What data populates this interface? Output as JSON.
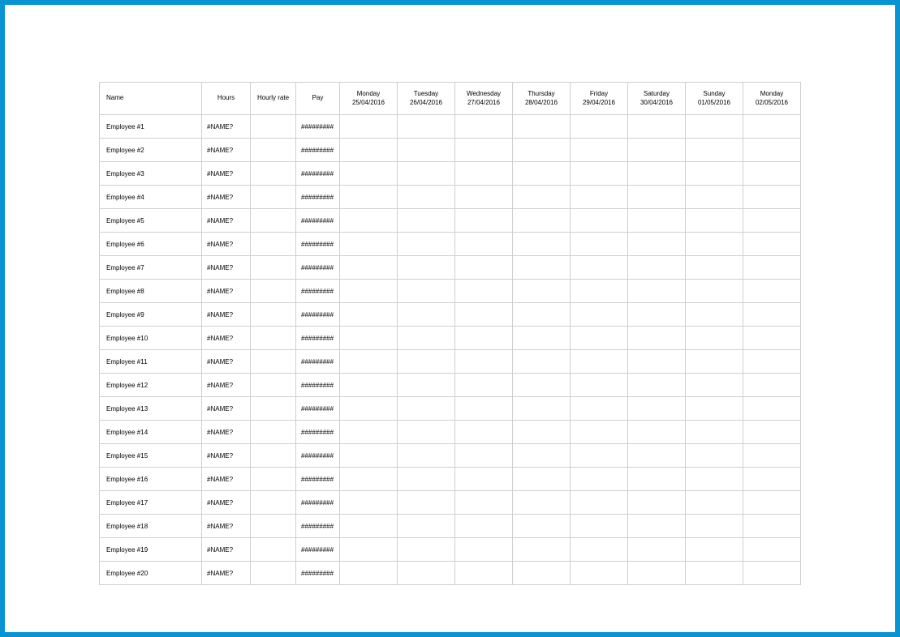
{
  "headers": {
    "name": "Name",
    "hours": "Hours",
    "rate": "Hourly rate",
    "pay": "Pay",
    "days": [
      {
        "dow": "Monday",
        "date": "25/04/2016"
      },
      {
        "dow": "Tuesday",
        "date": "26/04/2016"
      },
      {
        "dow": "Wednesday",
        "date": "27/04/2016"
      },
      {
        "dow": "Thursday",
        "date": "28/04/2016"
      },
      {
        "dow": "Friday",
        "date": "29/04/2016"
      },
      {
        "dow": "Saturday",
        "date": "30/04/2016"
      },
      {
        "dow": "Sunday",
        "date": "01/05/2016"
      },
      {
        "dow": "Monday",
        "date": "02/05/2016"
      }
    ]
  },
  "rows": [
    {
      "name": "Employee #1",
      "hours": "#NAME?",
      "rate": "",
      "pay": "#########",
      "days": [
        "",
        "",
        "",
        "",
        "",
        "",
        "",
        ""
      ]
    },
    {
      "name": "Employee #2",
      "hours": "#NAME?",
      "rate": "",
      "pay": "#########",
      "days": [
        "",
        "",
        "",
        "",
        "",
        "",
        "",
        ""
      ]
    },
    {
      "name": "Employee #3",
      "hours": "#NAME?",
      "rate": "",
      "pay": "#########",
      "days": [
        "",
        "",
        "",
        "",
        "",
        "",
        "",
        ""
      ]
    },
    {
      "name": "Employee #4",
      "hours": "#NAME?",
      "rate": "",
      "pay": "#########",
      "days": [
        "",
        "",
        "",
        "",
        "",
        "",
        "",
        ""
      ]
    },
    {
      "name": "Employee #5",
      "hours": "#NAME?",
      "rate": "",
      "pay": "#########",
      "days": [
        "",
        "",
        "",
        "",
        "",
        "",
        "",
        ""
      ]
    },
    {
      "name": "Employee #6",
      "hours": "#NAME?",
      "rate": "",
      "pay": "#########",
      "days": [
        "",
        "",
        "",
        "",
        "",
        "",
        "",
        ""
      ]
    },
    {
      "name": "Employee #7",
      "hours": "#NAME?",
      "rate": "",
      "pay": "#########",
      "days": [
        "",
        "",
        "",
        "",
        "",
        "",
        "",
        ""
      ]
    },
    {
      "name": "Employee #8",
      "hours": "#NAME?",
      "rate": "",
      "pay": "#########",
      "days": [
        "",
        "",
        "",
        "",
        "",
        "",
        "",
        ""
      ]
    },
    {
      "name": "Employee #9",
      "hours": "#NAME?",
      "rate": "",
      "pay": "#########",
      "days": [
        "",
        "",
        "",
        "",
        "",
        "",
        "",
        ""
      ]
    },
    {
      "name": "Employee #10",
      "hours": "#NAME?",
      "rate": "",
      "pay": "#########",
      "days": [
        "",
        "",
        "",
        "",
        "",
        "",
        "",
        ""
      ]
    },
    {
      "name": "Employee #11",
      "hours": "#NAME?",
      "rate": "",
      "pay": "#########",
      "days": [
        "",
        "",
        "",
        "",
        "",
        "",
        "",
        ""
      ]
    },
    {
      "name": "Employee #12",
      "hours": "#NAME?",
      "rate": "",
      "pay": "#########",
      "days": [
        "",
        "",
        "",
        "",
        "",
        "",
        "",
        ""
      ]
    },
    {
      "name": "Employee #13",
      "hours": "#NAME?",
      "rate": "",
      "pay": "#########",
      "days": [
        "",
        "",
        "",
        "",
        "",
        "",
        "",
        ""
      ]
    },
    {
      "name": "Employee #14",
      "hours": "#NAME?",
      "rate": "",
      "pay": "#########",
      "days": [
        "",
        "",
        "",
        "",
        "",
        "",
        "",
        ""
      ]
    },
    {
      "name": "Employee #15",
      "hours": "#NAME?",
      "rate": "",
      "pay": "#########",
      "days": [
        "",
        "",
        "",
        "",
        "",
        "",
        "",
        ""
      ]
    },
    {
      "name": "Employee #16",
      "hours": "#NAME?",
      "rate": "",
      "pay": "#########",
      "days": [
        "",
        "",
        "",
        "",
        "",
        "",
        "",
        ""
      ]
    },
    {
      "name": "Employee #17",
      "hours": "#NAME?",
      "rate": "",
      "pay": "#########",
      "days": [
        "",
        "",
        "",
        "",
        "",
        "",
        "",
        ""
      ]
    },
    {
      "name": "Employee #18",
      "hours": "#NAME?",
      "rate": "",
      "pay": "#########",
      "days": [
        "",
        "",
        "",
        "",
        "",
        "",
        "",
        ""
      ]
    },
    {
      "name": "Employee #19",
      "hours": "#NAME?",
      "rate": "",
      "pay": "#########",
      "days": [
        "",
        "",
        "",
        "",
        "",
        "",
        "",
        ""
      ]
    },
    {
      "name": "Employee #20",
      "hours": "#NAME?",
      "rate": "",
      "pay": "#########",
      "days": [
        "",
        "",
        "",
        "",
        "",
        "",
        "",
        ""
      ]
    }
  ]
}
